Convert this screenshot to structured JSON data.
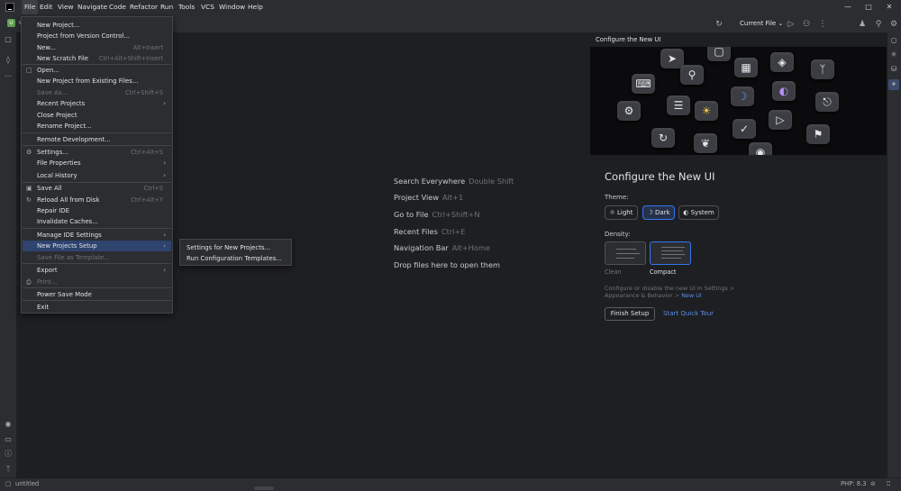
{
  "menubar": {
    "items": [
      "File",
      "Edit",
      "View",
      "Navigate",
      "Code",
      "Refactor",
      "Run",
      "Tools",
      "VCS",
      "Window",
      "Help"
    ]
  },
  "toolbar": {
    "project_letter": "U",
    "project_name": "u",
    "run_config": "Current File"
  },
  "file_menu": {
    "items": [
      {
        "label": "New Project...",
        "shortcut": ""
      },
      {
        "label": "Project from Version Control...",
        "shortcut": ""
      },
      {
        "label": "New...",
        "shortcut": "Alt+Insert"
      },
      {
        "label": "New Scratch File",
        "shortcut": "Ctrl+Alt+Shift+Insert"
      },
      {
        "label": "Open...",
        "shortcut": ""
      },
      {
        "label": "New Project from Existing Files...",
        "shortcut": ""
      },
      {
        "label": "Save As...",
        "shortcut": "Ctrl+Shift+S"
      },
      {
        "label": "Recent Projects",
        "shortcut": ""
      },
      {
        "label": "Close Project",
        "shortcut": ""
      },
      {
        "label": "Rename Project...",
        "shortcut": ""
      },
      {
        "label": "Remote Development...",
        "shortcut": ""
      },
      {
        "label": "Settings...",
        "shortcut": "Ctrl+Alt+S"
      },
      {
        "label": "File Properties",
        "shortcut": ""
      },
      {
        "label": "Local History",
        "shortcut": ""
      },
      {
        "label": "Save All",
        "shortcut": "Ctrl+S"
      },
      {
        "label": "Reload All from Disk",
        "shortcut": "Ctrl+Alt+Y"
      },
      {
        "label": "Repair IDE",
        "shortcut": ""
      },
      {
        "label": "Invalidate Caches...",
        "shortcut": ""
      },
      {
        "label": "Manage IDE Settings",
        "shortcut": ""
      },
      {
        "label": "New Projects Setup",
        "shortcut": ""
      },
      {
        "label": "Save File as Template...",
        "shortcut": ""
      },
      {
        "label": "Export",
        "shortcut": ""
      },
      {
        "label": "Print...",
        "shortcut": ""
      },
      {
        "label": "Power Save Mode",
        "shortcut": ""
      },
      {
        "label": "Exit",
        "shortcut": ""
      }
    ]
  },
  "submenu": {
    "items": [
      "Settings for New Projects...",
      "Run Configuration Templates..."
    ]
  },
  "hints": [
    {
      "label": "Search Everywhere",
      "key": "Double Shift"
    },
    {
      "label": "Project View",
      "key": "Alt+1"
    },
    {
      "label": "Go to File",
      "key": "Ctrl+Shift+N"
    },
    {
      "label": "Recent Files",
      "key": "Ctrl+E"
    },
    {
      "label": "Navigation Bar",
      "key": "Alt+Home"
    },
    {
      "label": "Drop files here to open them",
      "key": ""
    }
  ],
  "new_ui": {
    "panel_title": "Configure the New UI",
    "heading": "Configure the New UI",
    "theme_label": "Theme:",
    "themes": [
      "Light",
      "Dark",
      "System"
    ],
    "selected_theme": "Dark",
    "density_label": "Density:",
    "densities": [
      "Clean",
      "Compact"
    ],
    "selected_density": "Compact",
    "note_text": "Configure or disable the new UI in Settings > Appearance & Behavior >",
    "note_link": "New UI",
    "finish_button": "Finish Setup",
    "tour_link": "Start Quick Tour"
  },
  "statusbar": {
    "project": "untitled",
    "php_version": "PHP: 8.3"
  },
  "colors": {
    "background": "#1e1f22",
    "panel": "#2b2d30",
    "accent": "#3574f0",
    "selection": "#2e436e",
    "link": "#5d8ee8"
  }
}
